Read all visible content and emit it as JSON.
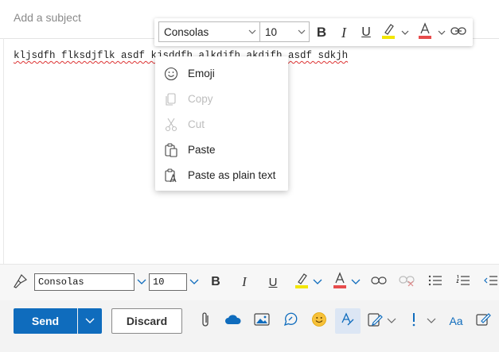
{
  "subject": {
    "placeholder": "Add a subject"
  },
  "body": {
    "text": "kljsdfh flksdjflk asdf kjsddfh alkdjfh akdjfh asdf sdkjh"
  },
  "float_toolbar": {
    "font": "Consolas",
    "size": "10",
    "highlight_color": "#f2e600",
    "font_color": "#e74c4c",
    "icons": [
      "chevron-down-icon",
      "bold-icon",
      "italic-icon",
      "underline-icon",
      "highlight-icon",
      "font-color-icon",
      "link-icon"
    ]
  },
  "context_menu": {
    "items": [
      {
        "label": "Emoji",
        "icon": "emoji-icon",
        "enabled": true
      },
      {
        "label": "Copy",
        "icon": "copy-icon",
        "enabled": false
      },
      {
        "label": "Cut",
        "icon": "scissors-icon",
        "enabled": false
      },
      {
        "label": "Paste",
        "icon": "paste-icon",
        "enabled": true
      },
      {
        "label": "Paste as plain text",
        "icon": "paste-plain-text-icon",
        "enabled": true
      }
    ]
  },
  "format_bar": {
    "font": "Consolas",
    "size": "10",
    "highlight_color": "#f2e600",
    "font_color": "#e74c4c",
    "icons": [
      "format-painter-icon",
      "bold-icon",
      "italic-icon",
      "underline-icon",
      "highlight-icon",
      "font-color-icon",
      "link-icon",
      "unlink-icon",
      "bullets-icon",
      "numbering-icon",
      "decrease-indent-icon"
    ]
  },
  "action_bar": {
    "send_label": "Send",
    "discard_label": "Discard",
    "accent": "#0f6cbd",
    "icons": [
      "attach-icon",
      "onedrive-cloud-icon",
      "image-icon",
      "loop-icon",
      "emoji-icon",
      "editor-icon",
      "signature-icon",
      "importance-icon",
      "format-text-icon",
      "immersive-icon"
    ]
  }
}
